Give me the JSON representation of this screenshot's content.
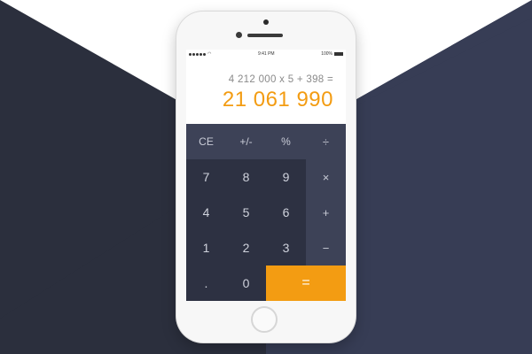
{
  "colors": {
    "background_dark": "#2b2f3d",
    "background_navy": "#373d55",
    "accent": "#f39c12",
    "keypad_bg": "#2d3142",
    "operator_bg": "#3d4257"
  },
  "status_bar": {
    "carrier": "",
    "time": "9:41 PM",
    "battery_percent": "100%",
    "signal_icon": "signal-dots-icon",
    "wifi_icon": "wifi-icon",
    "battery_icon": "battery-icon"
  },
  "display": {
    "expression": "4 212 000 x 5 + 398 =",
    "result": "21 061 990"
  },
  "keypad": {
    "row1": [
      "CE",
      "+/-",
      "%",
      "÷"
    ],
    "row2": [
      "7",
      "8",
      "9",
      "×"
    ],
    "row3": [
      "4",
      "5",
      "6",
      "+"
    ],
    "row4": [
      "1",
      "2",
      "3",
      "−"
    ],
    "row5": [
      ".",
      "0",
      "="
    ]
  }
}
